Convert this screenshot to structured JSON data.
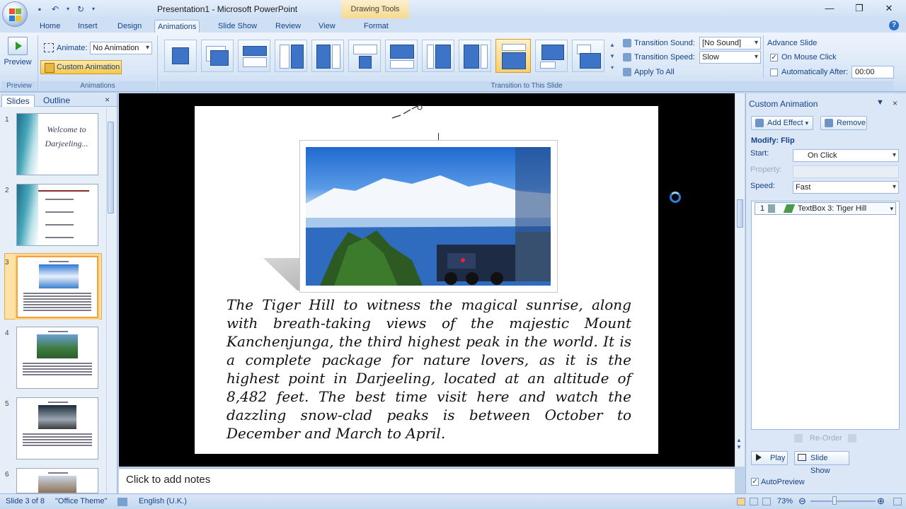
{
  "window": {
    "title": "Presentation1 - Microsoft PowerPoint",
    "context_tab": "Drawing Tools"
  },
  "tabs": [
    "Home",
    "Insert",
    "Design",
    "Animations",
    "Slide Show",
    "Review",
    "View",
    "Format"
  ],
  "ribbon": {
    "preview_label": "Preview",
    "preview_group": "Preview",
    "animate_label": "Animate:",
    "animate_value": "No Animation",
    "custom_animation_label": "Custom Animation",
    "animations_group": "Animations",
    "transition_sound_label": "Transition Sound:",
    "transition_sound_value": "[No Sound]",
    "transition_speed_label": "Transition Speed:",
    "transition_speed_value": "Slow",
    "apply_to_all": "Apply To All",
    "transition_group": "Transition to This Slide",
    "advance_title": "Advance Slide",
    "on_mouse_click": "On Mouse Click",
    "automatically_after": "Automatically After:",
    "auto_time": "00:00"
  },
  "slides_pane": {
    "tab_slides": "Slides",
    "tab_outline": "Outline",
    "close": "×",
    "numbers": [
      "1",
      "2",
      "3",
      "4",
      "5",
      "6"
    ],
    "slide1_text": "Welcome to Darjeeling..."
  },
  "slide": {
    "body": "The Tiger Hill to witness the magical sunrise, along with breath-taking views of the majestic Mount Kanchenjunga, the third highest peak in the world. It is a complete package for nature lovers, as it is the highest point in Darjeeling, located at an altitude of 8,482 feet. The best time visit here and watch the dazzling snow-clad peaks is between October to December and March to April."
  },
  "notes": {
    "placeholder": "Click to add notes"
  },
  "task_pane": {
    "title": "Custom Animation",
    "add_effect": "Add Effect",
    "remove": "Remove",
    "modify": "Modify: Flip",
    "start_label": "Start:",
    "start_value": "On Click",
    "property_label": "Property:",
    "speed_label": "Speed:",
    "speed_value": "Fast",
    "item_number": "1",
    "item_label": "TextBox 3: Tiger Hill",
    "reorder": "Re-Order",
    "play": "Play",
    "slide_show": "Slide Show",
    "autopreview": "AutoPreview"
  },
  "status": {
    "slide": "Slide 3 of 8",
    "theme": "\"Office Theme\"",
    "language": "English (U.K.)",
    "zoom": "73%"
  }
}
